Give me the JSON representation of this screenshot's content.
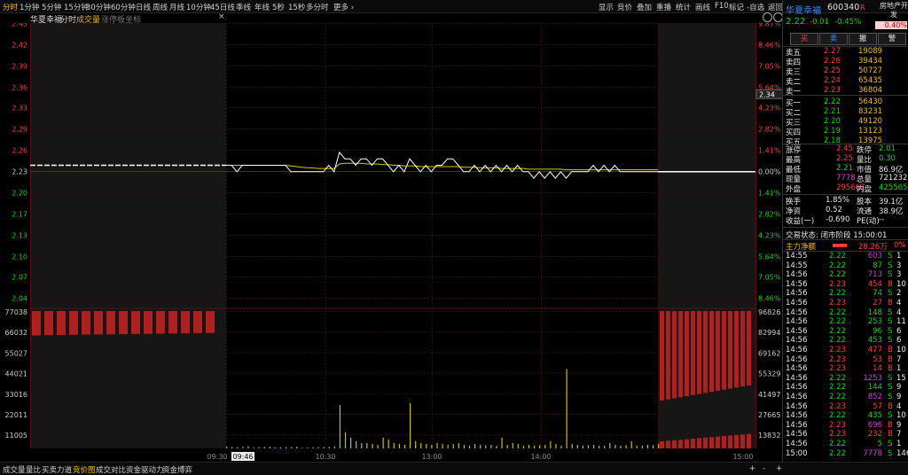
{
  "toolbar": {
    "left_items": [
      "分时",
      "1分钟",
      "5分钟",
      "15分钟",
      "30分钟",
      "60分钟",
      "日线",
      "周线",
      "月线",
      "10分钟",
      "45日线",
      "季线",
      "年线",
      "5秒",
      "15秒",
      "多分时",
      "更多 ›"
    ],
    "right_items": [
      "显示",
      "竞价",
      "叠加",
      "重播",
      "统计",
      "画线",
      "F10",
      "标记",
      "-自选",
      "返回"
    ]
  },
  "subbar": {
    "stock_name": "华夏幸福",
    "tab_fenshi": "分时",
    "tab_volume": "成交量",
    "tab_limit": "涨停板坐标",
    "close_glyph": "×"
  },
  "bottom_tabs": [
    "成交量",
    "量比",
    "买卖力道",
    "竞价图",
    "成交对比",
    "资金驱动力",
    "资金博弈"
  ],
  "bottom_active": "竞价图",
  "bottom_controls": [
    "+",
    "-",
    "+"
  ],
  "cursor": {
    "price_label": "2.34",
    "time_label": "09:46"
  },
  "colors": {
    "up": "#ff3b3b",
    "down": "#19d219",
    "price_line": "#ffffff",
    "avg_line": "#d8c800",
    "volume_bar": "#c8c000",
    "grid": "#3a0c0c"
  },
  "chart_data": {
    "type": "line",
    "title": "",
    "prev_close": 2.23,
    "price_axis": {
      "ylim": [
        2.01,
        2.45
      ],
      "ticks": [
        "2.45",
        "2.42",
        "2.39",
        "2.36",
        "2.33",
        "2.29",
        "2.26",
        "2.23",
        "2.20",
        "2.17",
        "2.13",
        "2.10",
        "2.07",
        "2.04"
      ],
      "pct_ticks": [
        "9.87%",
        "8.46%",
        "7.05%",
        "5.64%",
        "4.23%",
        "2.82%",
        "1.41%",
        "0.00%",
        "1.41%",
        "2.82%",
        "4.23%",
        "5.64%",
        "7.05%",
        "8.46%"
      ]
    },
    "volume_axis": {
      "left_ticks": [
        "77038",
        "66032",
        "55027",
        "44021",
        "33016",
        "22011",
        "11005"
      ],
      "right_ticks": [
        "96826",
        "82994",
        "69162",
        "55329",
        "41497",
        "27665",
        "13832"
      ]
    },
    "x_ticks": [
      "09:30",
      "10:30",
      "13:00",
      "14:00",
      "15:00"
    ],
    "series": [
      {
        "values": [
          2.23,
          2.23,
          2.22,
          2.23,
          2.23,
          2.23,
          2.23,
          2.23,
          2.23,
          2.23,
          2.23,
          2.23,
          2.22,
          2.22,
          2.22,
          2.22,
          2.22,
          2.22,
          2.22,
          2.23,
          2.22,
          2.25,
          2.24,
          2.24,
          2.23,
          2.24,
          2.24,
          2.23,
          2.24,
          2.24,
          2.23,
          2.22,
          2.23,
          2.22,
          2.24,
          2.23,
          2.22,
          2.23,
          2.22,
          2.23,
          2.23,
          2.24,
          2.24,
          2.23,
          2.22,
          2.22,
          2.23,
          2.22,
          2.23,
          2.22,
          2.23,
          2.22,
          2.23,
          2.22,
          2.23,
          2.22,
          2.22,
          2.21,
          2.22,
          2.21,
          2.22,
          2.21,
          2.22,
          2.21,
          2.22,
          2.22,
          2.22,
          2.22,
          2.23,
          2.22,
          2.23,
          2.22,
          2.23,
          2.22,
          2.22,
          2.22,
          2.22,
          2.22,
          2.22,
          2.22,
          2.22
        ]
      },
      {
        "values": [
          2.23,
          2.23,
          2.23,
          2.23,
          2.23,
          2.23,
          2.23,
          2.23,
          2.23,
          2.23,
          2.23,
          2.23,
          2.229,
          2.228,
          2.227,
          2.226,
          2.226,
          2.225,
          2.225,
          2.225,
          2.225,
          2.232,
          2.233,
          2.233,
          2.233,
          2.233,
          2.232,
          2.232,
          2.232,
          2.231,
          2.231,
          2.23,
          2.23,
          2.229,
          2.229,
          2.229,
          2.228,
          2.228,
          2.228,
          2.228,
          2.228,
          2.228,
          2.228,
          2.228,
          2.227,
          2.227,
          2.227,
          2.226,
          2.226,
          2.226,
          2.226,
          2.225,
          2.225,
          2.225,
          2.225,
          2.225,
          2.224,
          2.224,
          2.224,
          2.224,
          2.224,
          2.224,
          2.224,
          2.223,
          2.223,
          2.223,
          2.223,
          2.223,
          2.223,
          2.223,
          2.223,
          2.223,
          2.223,
          2.223,
          2.223,
          2.223,
          2.223,
          2.223,
          2.223,
          2.223,
          2.223
        ]
      }
    ],
    "volume": [
      900,
      800,
      700,
      900,
      1200,
      600,
      700,
      800,
      900,
      500,
      600,
      700,
      800,
      900,
      400,
      500,
      600,
      700,
      800,
      900,
      1200,
      24000,
      9000,
      6000,
      4000,
      3000,
      3000,
      2500,
      2000,
      6000,
      5000,
      3000,
      2500,
      2000,
      25000,
      4000,
      3000,
      2500,
      2000,
      3000,
      2500,
      2000,
      2500,
      3000,
      2000,
      1500,
      2500,
      2000,
      1800,
      2000,
      1500,
      6000,
      2000,
      3000,
      2500,
      1500,
      2000,
      1500,
      1800,
      2000,
      4000,
      2500,
      1500,
      44000,
      2500,
      2000,
      1500,
      1800,
      2000,
      1500,
      1500,
      3000,
      2000,
      1500,
      1800,
      4000,
      1500,
      1500,
      2000,
      1800,
      2500
    ],
    "auction_left": [
      75000,
      74000,
      73500,
      73000,
      72500,
      72000,
      71500,
      71000,
      70500,
      70000,
      69500,
      69000,
      68500,
      68000,
      67500
    ],
    "auction_right": [
      82994,
      82000,
      81000,
      80000,
      79000,
      78000,
      77000,
      76000,
      75000,
      74000,
      73000,
      72000,
      71000,
      70000,
      69000
    ]
  },
  "quote": {
    "name": "华夏幸福",
    "code": "600340",
    "flag": "R",
    "sector": "房地产开发",
    "sector_pct": "0.40%",
    "price": "2.22",
    "change": "-0.01",
    "change_pct": "-0.45%",
    "buttons": [
      "买",
      "卖",
      "撤",
      "警"
    ]
  },
  "asks": [
    {
      "label": "卖五",
      "price": "2.27",
      "vol": "19089"
    },
    {
      "label": "卖四",
      "price": "2.26",
      "vol": "39434"
    },
    {
      "label": "卖三",
      "price": "2.25",
      "vol": "50727"
    },
    {
      "label": "卖二",
      "price": "2.24",
      "vol": "65435"
    },
    {
      "label": "卖一",
      "price": "2.23",
      "vol": "36804"
    }
  ],
  "bids": [
    {
      "label": "买一",
      "price": "2.22",
      "vol": "56430"
    },
    {
      "label": "买二",
      "price": "2.21",
      "vol": "83231"
    },
    {
      "label": "买三",
      "price": "2.20",
      "vol": "49120"
    },
    {
      "label": "买四",
      "price": "2.19",
      "vol": "13123"
    },
    {
      "label": "买五",
      "price": "2.18",
      "vol": "13975"
    }
  ],
  "stats": [
    {
      "l1": "涨停",
      "v1": "2.45",
      "c1": "red",
      "l2": "跌停",
      "v2": "2.01",
      "c2": "green"
    },
    {
      "l1": "最高",
      "v1": "2.25",
      "c1": "red",
      "l2": "量比",
      "v2": "0.30",
      "c2": "green"
    },
    {
      "l1": "最低",
      "v1": "2.21",
      "c1": "green",
      "l2": "市值",
      "v2": "86.9亿",
      "c2": "white"
    },
    {
      "l1": "现量",
      "v1": "7778",
      "c1": "purple",
      "l2": "总量",
      "v2": "721232",
      "c2": "white"
    },
    {
      "l1": "外盘",
      "v1": "295667",
      "c1": "red",
      "l2": "内盘",
      "v2": "425565",
      "c2": "green"
    }
  ],
  "stats2": [
    {
      "l1": "换手",
      "v1": "1.85%",
      "l2": "股本",
      "v2": "39.1亿"
    },
    {
      "l1": "净资",
      "v1": "0.52",
      "l2": "流通",
      "v2": "38.9亿"
    },
    {
      "l1": "收益(一)",
      "v1": "-0.690",
      "l2": "PE(动)",
      "v2": "--"
    }
  ],
  "trade_status": "交易状态: 闭市阶段 15:00:01",
  "main_net": {
    "label": "主力净额",
    "value": "28.26万",
    "pct": "0%"
  },
  "ticks": [
    {
      "t": "14:55",
      "p": "2.22",
      "v": "603",
      "s": "S",
      "n": "1"
    },
    {
      "t": "14:55",
      "p": "2.22",
      "v": "87",
      "s": "S",
      "n": "3"
    },
    {
      "t": "14:56",
      "p": "2.22",
      "v": "713",
      "s": "S",
      "n": "3"
    },
    {
      "t": "14:56",
      "p": "2.23",
      "v": "454",
      "s": "B",
      "n": "10"
    },
    {
      "t": "14:56",
      "p": "2.22",
      "v": "74",
      "s": "S",
      "n": "2"
    },
    {
      "t": "14:56",
      "p": "2.23",
      "v": "27",
      "s": "B",
      "n": "4"
    },
    {
      "t": "14:56",
      "p": "2.22",
      "v": "148",
      "s": "S",
      "n": "4"
    },
    {
      "t": "14:56",
      "p": "2.22",
      "v": "253",
      "s": "S",
      "n": "11"
    },
    {
      "t": "14:56",
      "p": "2.22",
      "v": "96",
      "s": "S",
      "n": "6"
    },
    {
      "t": "14:56",
      "p": "2.22",
      "v": "453",
      "s": "S",
      "n": "6"
    },
    {
      "t": "14:56",
      "p": "2.23",
      "v": "477",
      "s": "B",
      "n": "10"
    },
    {
      "t": "14:56",
      "p": "2.23",
      "v": "53",
      "s": "B",
      "n": "7"
    },
    {
      "t": "14:56",
      "p": "2.23",
      "v": "14",
      "s": "B",
      "n": "1"
    },
    {
      "t": "14:56",
      "p": "2.22",
      "v": "1253",
      "s": "S",
      "n": "15"
    },
    {
      "t": "14:56",
      "p": "2.22",
      "v": "144",
      "s": "S",
      "n": "9"
    },
    {
      "t": "14:56",
      "p": "2.22",
      "v": "852",
      "s": "S",
      "n": "9"
    },
    {
      "t": "14:56",
      "p": "2.23",
      "v": "57",
      "s": "B",
      "n": "4"
    },
    {
      "t": "14:56",
      "p": "2.22",
      "v": "435",
      "s": "S",
      "n": "10"
    },
    {
      "t": "14:56",
      "p": "2.23",
      "v": "696",
      "s": "B",
      "n": "9"
    },
    {
      "t": "14:56",
      "p": "2.23",
      "v": "232",
      "s": "B",
      "n": "7"
    },
    {
      "t": "14:56",
      "p": "2.22",
      "v": "5",
      "s": "S",
      "n": "1"
    },
    {
      "t": "15:00",
      "p": "2.22",
      "v": "7778",
      "s": "S",
      "n": "146"
    }
  ]
}
